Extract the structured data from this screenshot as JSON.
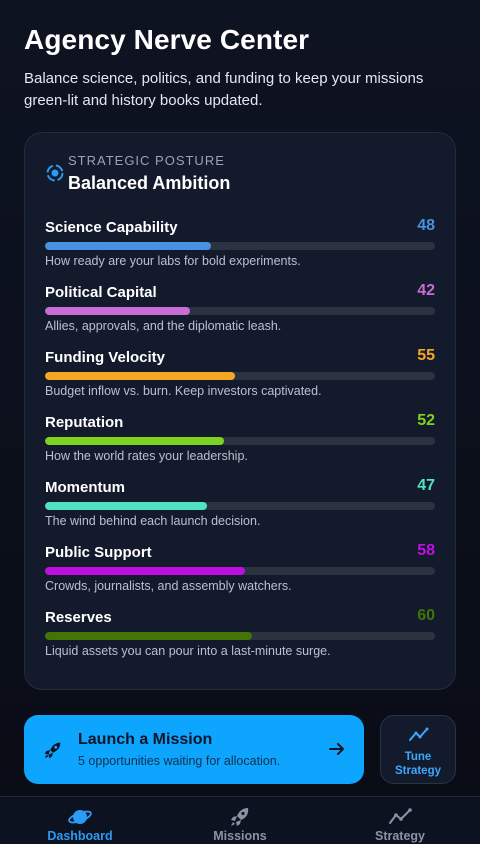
{
  "header": {
    "title": "Agency Nerve Center",
    "subtitle": "Balance science, politics, and funding to keep your missions green-lit and history books updated."
  },
  "posture": {
    "kicker": "STRATEGIC POSTURE",
    "title": "Balanced Ambition",
    "icon": "orbit-icon",
    "max_value": 100,
    "metrics": [
      {
        "name": "Science Capability",
        "value": 48,
        "color": "#4a90e2",
        "desc": "How ready are your labs for bold experiments."
      },
      {
        "name": "Political Capital",
        "value": 42,
        "color": "#c86dd7",
        "desc": "Allies, approvals, and the diplomatic leash."
      },
      {
        "name": "Funding Velocity",
        "value": 55,
        "color": "#f5a623",
        "desc": "Budget inflow vs. burn. Keep investors captivated."
      },
      {
        "name": "Reputation",
        "value": 52,
        "color": "#7ed321",
        "desc": "How the world rates your leadership."
      },
      {
        "name": "Momentum",
        "value": 47,
        "color": "#50e3c2",
        "desc": "The wind behind each launch decision."
      },
      {
        "name": "Public Support",
        "value": 58,
        "color": "#bd10e0",
        "desc": "Crowds, journalists, and assembly watchers."
      },
      {
        "name": "Reserves",
        "value": 60,
        "color": "#417505",
        "desc": "Liquid assets you can pour into a last-minute surge."
      }
    ]
  },
  "actions": {
    "launch": {
      "title": "Launch a Mission",
      "subtitle": "5 opportunities waiting for allocation.",
      "icon": "rocket-icon",
      "arrow_icon": "arrow-right-icon",
      "color": "#0ea5ff"
    },
    "tune": {
      "label": "Tune Strategy",
      "icon": "trend-line-icon"
    }
  },
  "tabs": [
    {
      "label": "Dashboard",
      "icon": "planet-icon",
      "active": true
    },
    {
      "label": "Missions",
      "icon": "rocket-icon",
      "active": false
    },
    {
      "label": "Strategy",
      "icon": "trend-line-icon",
      "active": false
    }
  ]
}
